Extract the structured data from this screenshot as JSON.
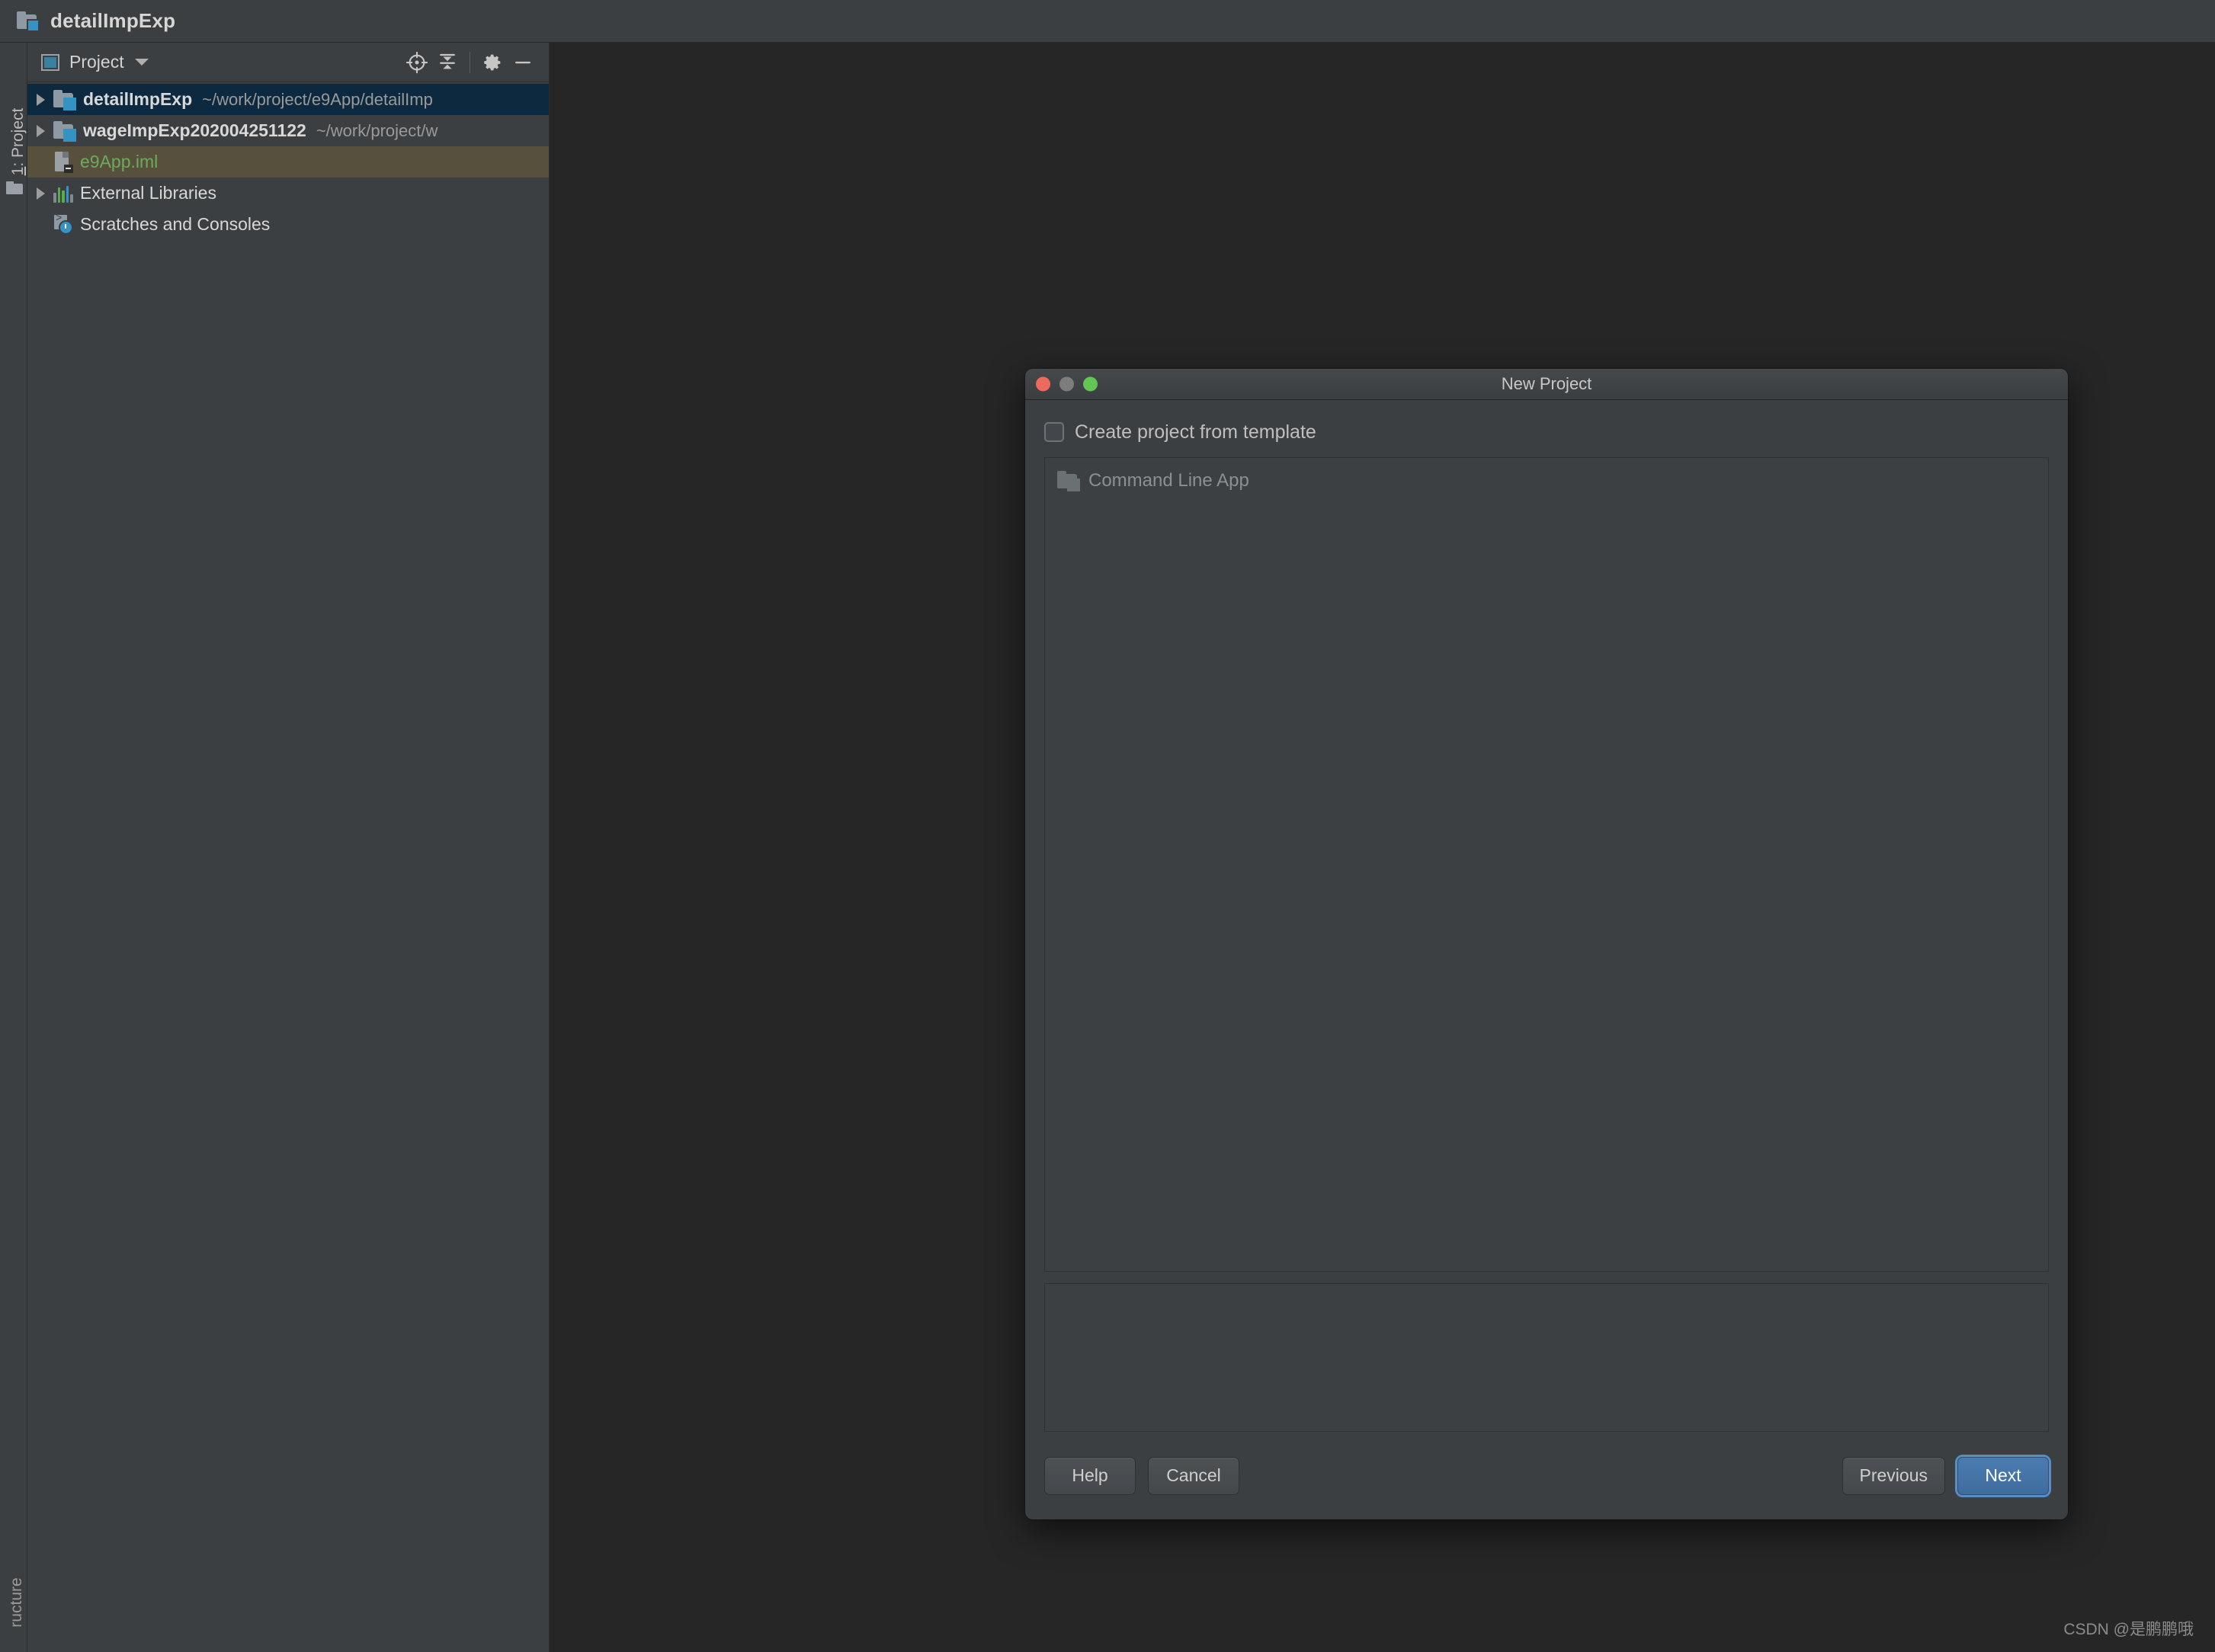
{
  "window": {
    "title": "detailImpExp",
    "title_icon": "module-folder-icon"
  },
  "toolstrip": {
    "project_tab_prefix": "1",
    "project_tab_label": ": Project",
    "project_tab_full": "1: Project",
    "bottom_tab_label": "ructure",
    "folder_icon": "folder-icon"
  },
  "project_panel": {
    "header": {
      "view_icon": "project-view-icon",
      "title": "Project",
      "caret_icon": "chevron-down-icon",
      "locate_icon": "scroll-from-source-icon",
      "collapse_icon": "collapse-all-icon",
      "settings_icon": "gear-icon",
      "hide_icon": "minimize-icon"
    },
    "tree": [
      {
        "name": "detailImpExp",
        "path": "~/work/project/e9App/detailImp",
        "icon": "module-folder-icon",
        "expandable": true,
        "state": "selected"
      },
      {
        "name": "wageImpExp202004251122",
        "path": "~/work/project/w",
        "icon": "module-folder-icon",
        "expandable": true,
        "state": "normal"
      },
      {
        "name": "e9App.iml",
        "path": "",
        "icon": "iml-file-icon",
        "expandable": false,
        "state": "highlighted"
      },
      {
        "name": "External Libraries",
        "path": "",
        "icon": "libraries-icon",
        "expandable": true,
        "state": "normal"
      },
      {
        "name": "Scratches and Consoles",
        "path": "",
        "icon": "scratches-icon",
        "expandable": false,
        "state": "normal"
      }
    ]
  },
  "editor": {
    "watermark": "CSDN @是鹏鹏哦"
  },
  "dialog": {
    "title": "New Project",
    "traffic_lights": {
      "close": "close-window-button",
      "minimize": "minimize-window-button",
      "zoom": "zoom-window-button"
    },
    "checkbox": {
      "label": "Create project from template",
      "checked": false
    },
    "templates": [
      {
        "label": "Command Line App",
        "icon": "module-folder-icon",
        "enabled": false
      }
    ],
    "description": "",
    "buttons": {
      "help": "Help",
      "cancel": "Cancel",
      "previous": "Previous",
      "next": "Next"
    }
  },
  "colors": {
    "panel_bg": "#3c3f41",
    "editor_bg": "#262626",
    "selection_blue": "#0d293f",
    "highlight_olive": "#57503c",
    "iml_green": "#6bab5b",
    "accent_blue": "#3592c4",
    "primary_button": "#4b7cb0"
  }
}
